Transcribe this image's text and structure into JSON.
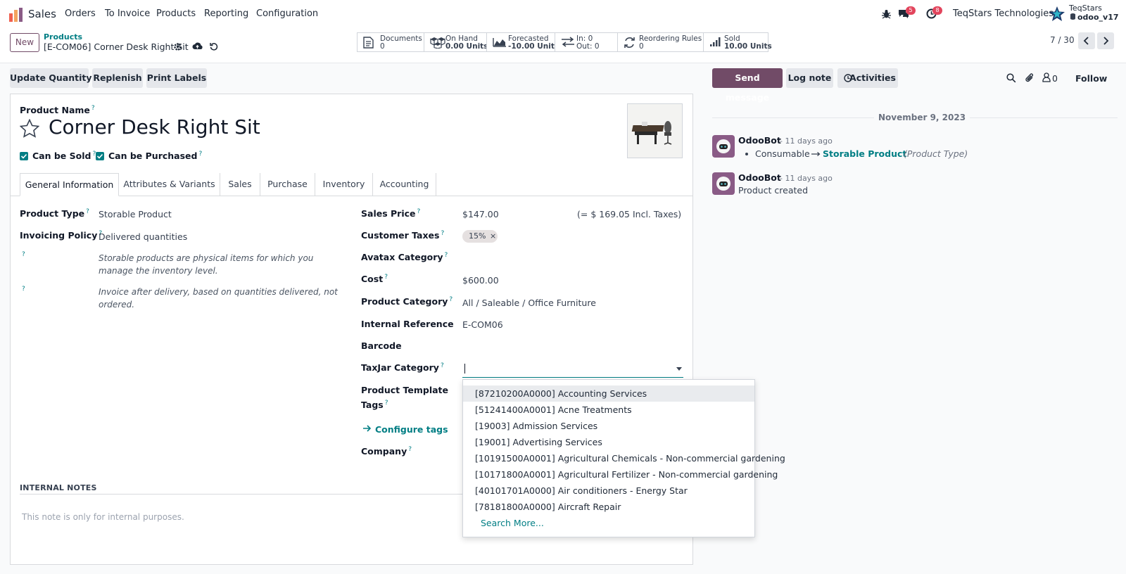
{
  "app": {
    "name": "Sales"
  },
  "menu": {
    "orders": "Orders",
    "to_invoice": "To Invoice",
    "products": "Products",
    "reporting": "Reporting",
    "configuration": "Configuration"
  },
  "systray": {
    "messages_count": "5",
    "activities_count": "8",
    "company": "TeqStars Technologies",
    "db_user": "TeqStars",
    "db_name": "odoo_v17"
  },
  "control": {
    "new_label": "New",
    "breadcrumb_parent": "Products",
    "breadcrumb_current": "[E-COM06] Corner Desk Right Sit",
    "pager": "7 / 30"
  },
  "smart_buttons": {
    "documents": {
      "label": "Documents",
      "value": "0"
    },
    "on_hand": {
      "label": "On Hand",
      "value": "0.00 Units"
    },
    "forecasted": {
      "label": "Forecasted",
      "value": "-10.00 Units"
    },
    "in_out": {
      "in": "In: 0",
      "out": "Out: 0"
    },
    "reordering": {
      "label": "Reordering Rules",
      "value": "0"
    },
    "sold": {
      "label": "Sold",
      "value": "10.00 Units"
    }
  },
  "actions": {
    "update_qty": "Update Quantity",
    "replenish": "Replenish",
    "print_labels": "Print Labels"
  },
  "chatter_actions": {
    "send_message": "Send message",
    "log_note": "Log note",
    "activities": "Activities",
    "followers_count": "0",
    "follow": "Follow"
  },
  "form": {
    "product_name_label": "Product Name",
    "product_name": "Corner Desk Right Sit",
    "can_be_sold": "Can be Sold",
    "can_be_purchased": "Can be Purchased",
    "tabs": [
      "General Information",
      "Attributes & Variants",
      "Sales",
      "Purchase",
      "Inventory",
      "Accounting"
    ],
    "product_type_label": "Product Type",
    "product_type": "Storable Product",
    "invoicing_policy_label": "Invoicing Policy",
    "invoicing_policy": "Delivered quantities",
    "help_product_type": "Storable products are physical items for which you manage the inventory level.",
    "help_invoicing": "Invoice after delivery, based on quantities delivered, not ordered.",
    "sales_price_label": "Sales Price",
    "sales_price": "$147.00",
    "incl_taxes": "(= $ 169.05 Incl. Taxes)",
    "customer_taxes_label": "Customer Taxes",
    "customer_tax_tag": "15%",
    "avatax_label": "Avatax Category",
    "cost_label": "Cost",
    "cost": "$600.00",
    "category_label": "Product Category",
    "category": "All / Saleable / Office Furniture",
    "internal_ref_label": "Internal Reference",
    "internal_ref": "E-COM06",
    "barcode_label": "Barcode",
    "taxjar_label": "TaxJar Category",
    "template_tags_label_1": "Product Template",
    "template_tags_label_2": "Tags",
    "configure_tags": "Configure tags",
    "company_label": "Company",
    "internal_notes_title": "INTERNAL NOTES",
    "internal_notes_placeholder": "This note is only for internal purposes."
  },
  "taxjar_dropdown": {
    "items": [
      "[87210200A0000] Accounting Services",
      "[51241400A0001] Acne Treatments",
      "[19003] Admission Services",
      "[19001] Advertising Services",
      "[10191500A0001] Agricultural Chemicals - Non-commercial gardening",
      "[10171800A0001] Agricultural Fertilizer - Non-commercial gardening",
      "[40101701A0000] Air conditioners - Energy Star",
      "[78181800A0000] Aircraft Repair"
    ],
    "search_more": "Search More..."
  },
  "chatter": {
    "date": "November 9, 2023",
    "messages": [
      {
        "author": "OdooBot",
        "time": "- 11 days ago",
        "old": "Consumable",
        "new": "Storable Product",
        "field": "(Product Type)"
      },
      {
        "author": "OdooBot",
        "time": "- 11 days ago",
        "body": "Product created"
      }
    ]
  },
  "colors": {
    "brand": "#714B67",
    "accent": "#017e84",
    "badge": "#e2445c"
  }
}
